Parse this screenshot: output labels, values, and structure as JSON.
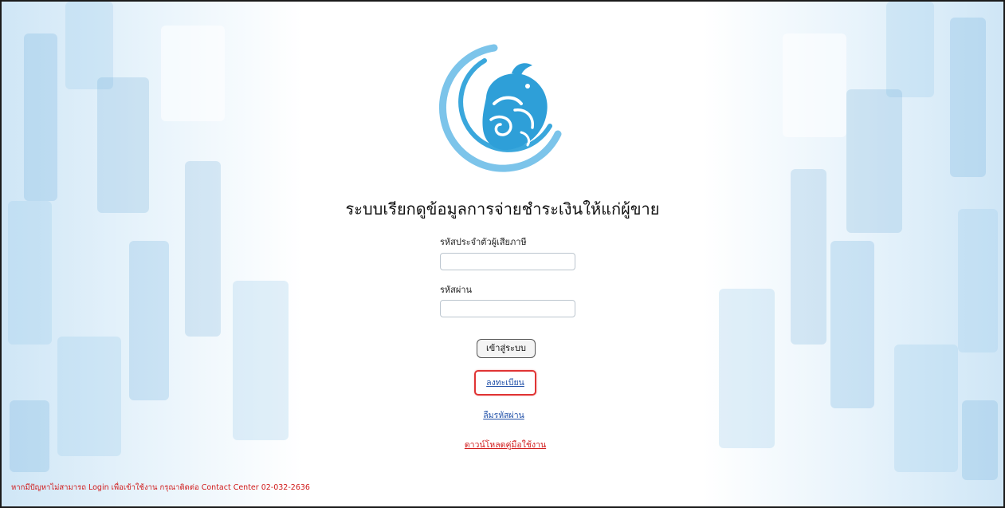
{
  "page": {
    "title": "ระบบเรียกดูข้อมูลการจ่ายชำระเงินให้แก่ผู้ขาย"
  },
  "form": {
    "taxid_label": "รหัสประจำตัวผู้เสียภาษี",
    "taxid_value": "",
    "password_label": "รหัสผ่าน",
    "password_value": "",
    "login_button": "เข้าสู่ระบบ"
  },
  "links": {
    "register": "ลงทะเบียน",
    "forgot_password": "ลืมรหัสผ่าน",
    "download_manual": "ดาวน์โหลดคู่มือใช้งาน"
  },
  "footer": {
    "contact_note": "หากมีปัญหาไม่สามารถ Login เพื่อเข้าใช้งาน กรุณาติดต่อ Contact Center 02-032-2636"
  },
  "colors": {
    "logo_blue": "#3aa7dc",
    "link_blue": "#1f4fa8",
    "alert_red": "#d11a1a",
    "highlight_red": "#e03434"
  },
  "icons": {
    "logo": "garuda-emblem-icon"
  }
}
